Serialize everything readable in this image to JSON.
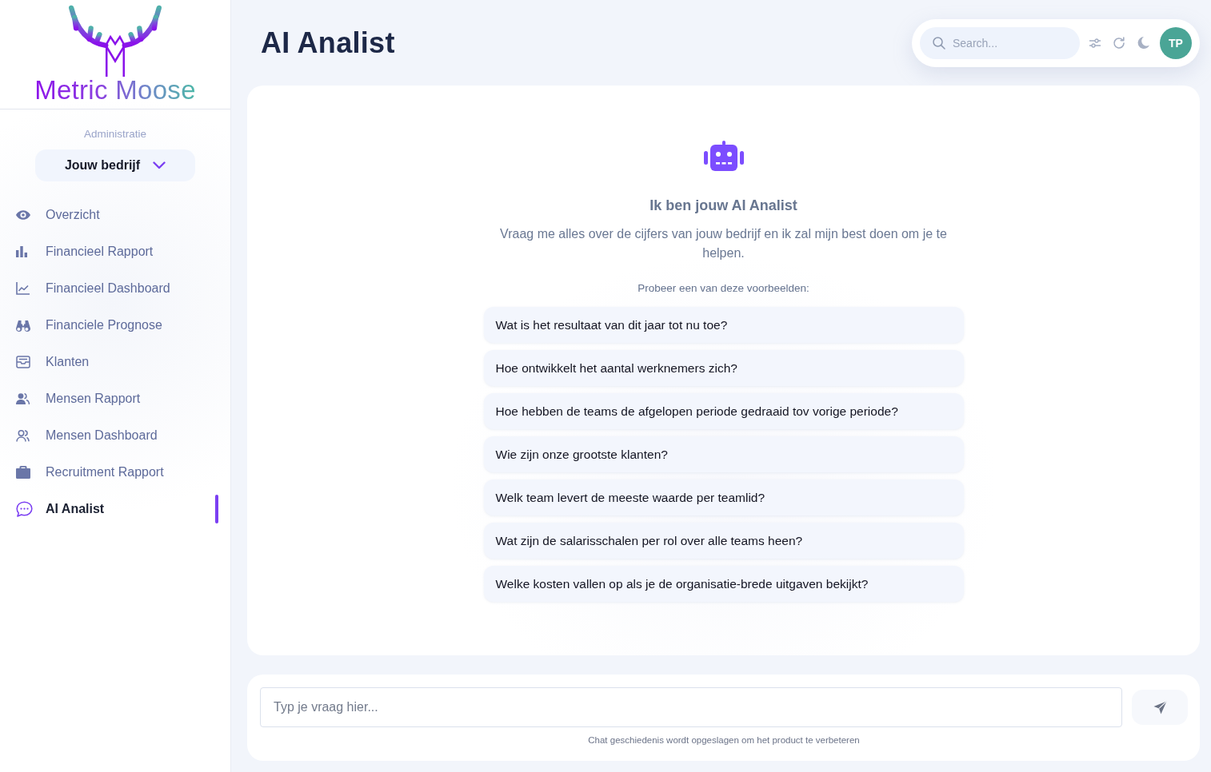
{
  "sidebar": {
    "logo": {
      "text": "Metric Moose"
    },
    "section_label": "Administratie",
    "company_select": {
      "value": "Jouw bedrijf"
    },
    "items": [
      {
        "label": "Overzicht",
        "selected": false
      },
      {
        "label": "Financieel Rapport",
        "selected": false
      },
      {
        "label": "Financieel Dashboard",
        "selected": false
      },
      {
        "label": "Financiele Prognose",
        "selected": false
      },
      {
        "label": "Klanten",
        "selected": false
      },
      {
        "label": "Mensen Rapport",
        "selected": false
      },
      {
        "label": "Mensen Dashboard",
        "selected": false
      },
      {
        "label": "Recruitment Rapport",
        "selected": false
      },
      {
        "label": "AI Analist",
        "selected": true
      }
    ]
  },
  "header": {
    "title": "AI Analist",
    "search": {
      "placeholder": "Search..."
    },
    "avatar": {
      "initials": "TP"
    }
  },
  "chat": {
    "heading": "Ik ben jouw AI Analist",
    "intro": "Vraag me alles over de cijfers van jouw bedrijf en ik zal mijn best doen om je te helpen.",
    "examples_label": "Probeer een van deze voorbeelden:",
    "examples": [
      "Wat is het resultaat van dit jaar tot nu toe?",
      "Hoe ontwikkelt het aantal werknemers zich?",
      "Hoe hebben de teams de afgelopen periode gedraaid tov vorige periode?",
      "Wie zijn onze grootste klanten?",
      "Welk team levert de meeste waarde per teamlid?",
      "Wat zijn de salarisschalen per rol over alle teams heen?",
      "Welke kosten vallen op als je de organisatie-brede uitgaven bekijkt?"
    ]
  },
  "composer": {
    "placeholder": "Typ je vraag hier...",
    "note": "Chat geschiedenis wordt opgeslagen om het product te verbeteren"
  }
}
